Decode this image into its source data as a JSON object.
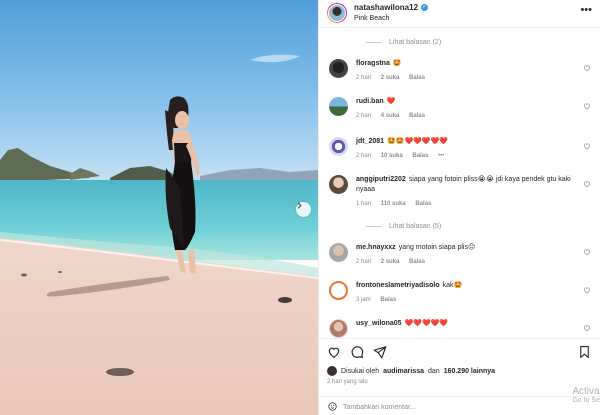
{
  "post": {
    "username": "natashawilona12",
    "location": "Pink Beach"
  },
  "replies_toggles": [
    {
      "label": "Lihat balasan (2)"
    },
    {
      "label": "Lihat balasan (5)"
    }
  ],
  "comments": [
    {
      "user": "floragstna",
      "text": "🤩",
      "time": "2 hari",
      "likes": "2 suka",
      "reply": "Balas",
      "extra": ""
    },
    {
      "user": "rudi.ban",
      "text": "❤️",
      "time": "2 hari",
      "likes": "4 suka",
      "reply": "Balas",
      "extra": ""
    },
    {
      "user": "jdt_2081",
      "text": "🤩🤩❤️❤️❤️❤️❤️",
      "time": "2 hari",
      "likes": "10 suka",
      "reply": "Balas",
      "extra": "•••"
    },
    {
      "user": "anggiputri2202",
      "text": "siapa yang fotoin pliss😭😭 jdi kaya pendek gtu kaki nyaaa",
      "time": "1 hari",
      "likes": "110 suka",
      "reply": "Balas",
      "extra": ""
    },
    {
      "user": "me.hnayxxz",
      "text": "yang motoin siapa plis😑",
      "time": "2 hari",
      "likes": "2 suka",
      "reply": "Balas",
      "extra": ""
    },
    {
      "user": "frontoneslametriyadisolo",
      "text": "kak🤩",
      "time": "3 jam",
      "likes": "",
      "reply": "Balas",
      "extra": ""
    },
    {
      "user": "usy_wilona05",
      "text": "❤️❤️❤️❤️❤️",
      "time": "",
      "likes": "",
      "reply": "",
      "extra": ""
    }
  ],
  "likes_line": {
    "prefix": "Disukai oleh",
    "user": "audimarissa",
    "middle": "dan",
    "count": "160.290 lainnya"
  },
  "posted_time": "2 hari yang lalu",
  "add_comment": {
    "placeholder": "Tambahkan komentar..."
  },
  "watermark": {
    "line1": "Activa",
    "line2": "Go to Se"
  },
  "colors": {
    "accent": "#3897f0",
    "muted": "#8e8e8e",
    "text": "#262626",
    "heart": "#ed4956"
  },
  "icons": [
    "more-icon",
    "verified-icon",
    "heart-icon",
    "comment-icon",
    "share-icon",
    "bookmark-icon",
    "emoji-icon",
    "chevron-right-icon"
  ]
}
